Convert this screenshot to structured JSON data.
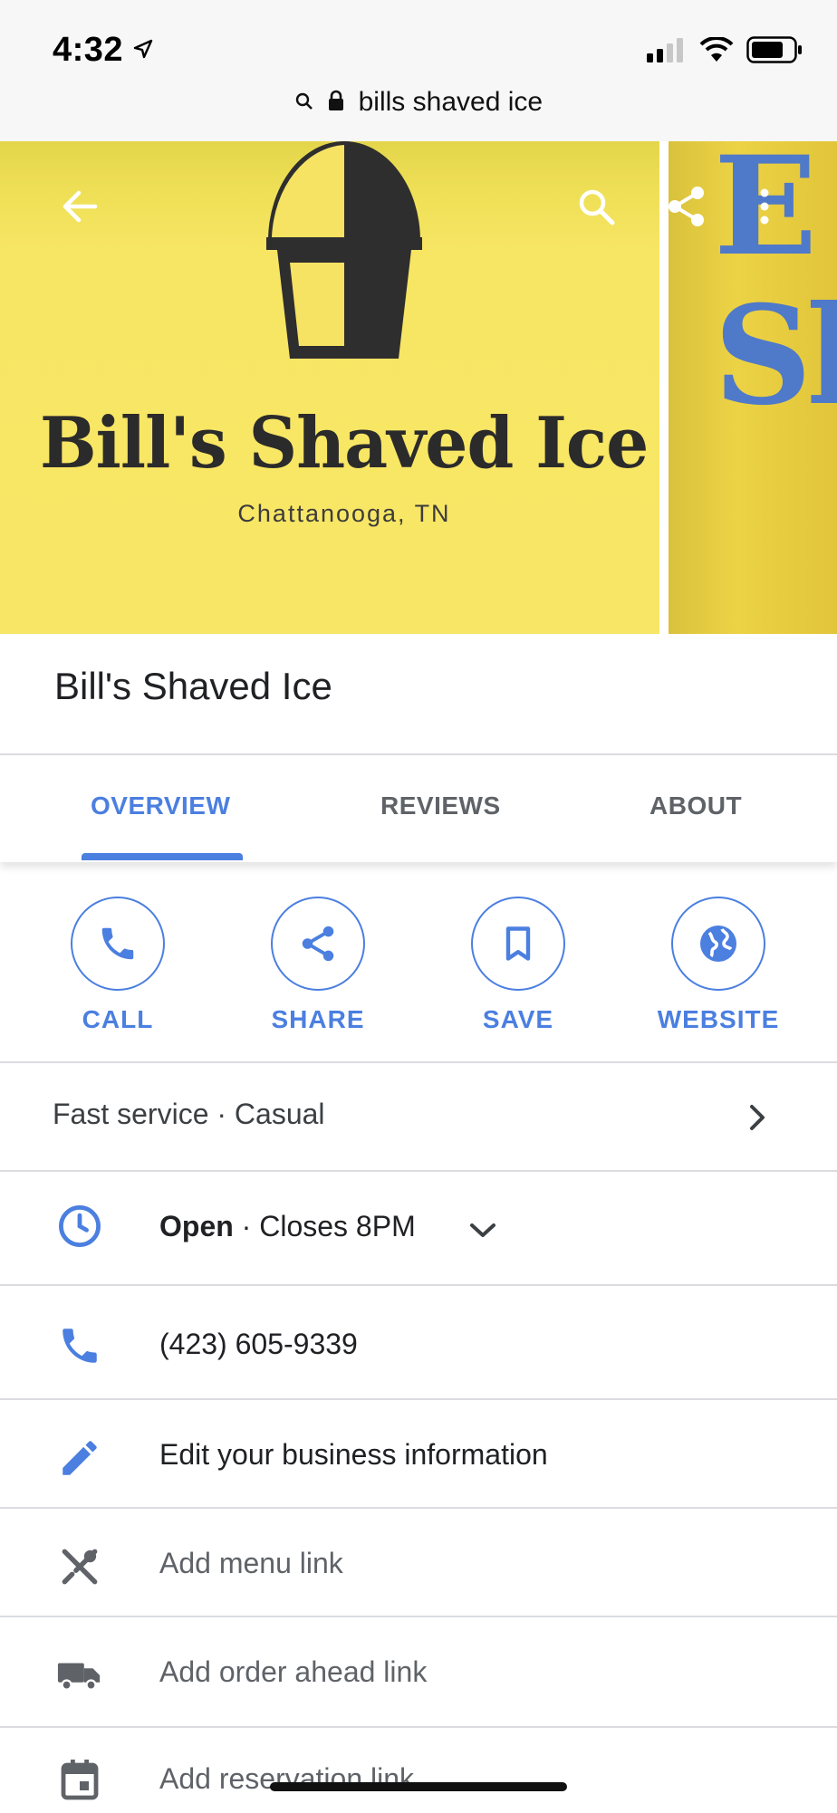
{
  "status_bar": {
    "time": "4:32",
    "url": "bills shaved ice"
  },
  "hero": {
    "brand_name": "Bill's Shaved Ice",
    "location": "Chattanooga, TN",
    "side_photo_letters": "E\nSh"
  },
  "place": {
    "title": "Bill's Shaved Ice"
  },
  "tabs": [
    {
      "label": "OVERVIEW",
      "active": true
    },
    {
      "label": "REVIEWS",
      "active": false
    },
    {
      "label": "ABOUT",
      "active": false
    }
  ],
  "actions": [
    {
      "label": "CALL",
      "icon": "phone-icon"
    },
    {
      "label": "SHARE",
      "icon": "share-icon"
    },
    {
      "label": "SAVE",
      "icon": "bookmark-icon"
    },
    {
      "label": "WEBSITE",
      "icon": "globe-icon"
    }
  ],
  "attributes": "Fast service · Casual",
  "hours": {
    "status": "Open",
    "detail": " · Closes 8PM"
  },
  "phone": "(423) 605-9339",
  "rows": {
    "edit": "Edit your business information",
    "menu": "Add menu link",
    "order": "Add order ahead link",
    "reservation": "Add reservation link"
  },
  "colors": {
    "accent": "#4b7fe0",
    "hero_yellow": "#f8e666",
    "divider": "#dadce0"
  }
}
